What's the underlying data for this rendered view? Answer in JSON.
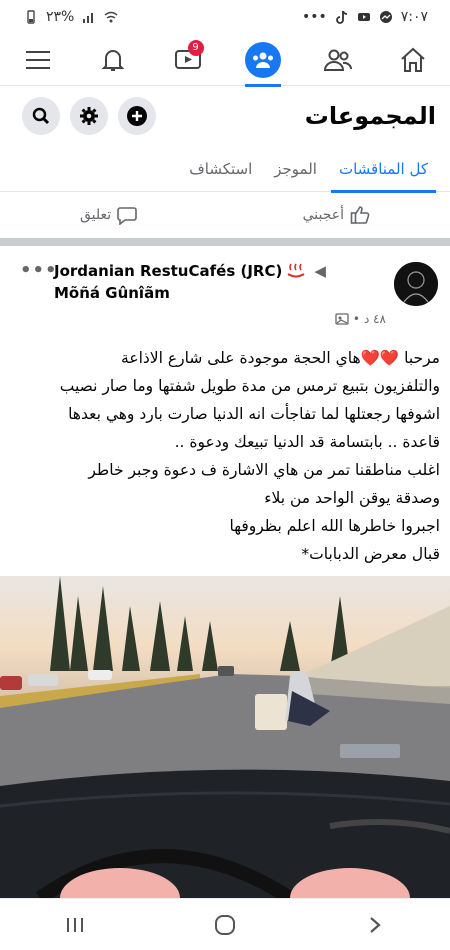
{
  "status_bar": {
    "time": "٧:٠٧",
    "battery": "٢٣%",
    "more": "•••"
  },
  "nav": {
    "items": [
      {
        "icon": "menu-icon"
      },
      {
        "icon": "bell-icon"
      },
      {
        "icon": "video-icon",
        "badge": "9"
      },
      {
        "icon": "groups-icon",
        "active": true
      },
      {
        "icon": "friends-icon"
      },
      {
        "icon": "home-icon"
      }
    ]
  },
  "header": {
    "title": "المجموعات"
  },
  "tabs": [
    {
      "label": "كل المناقشات",
      "active": true
    },
    {
      "label": "الموجز"
    },
    {
      "label": "استكشاف"
    }
  ],
  "reactions": {
    "like_label": "أعجبني",
    "comment_label": "تعليق"
  },
  "post": {
    "group_name": "Jordanian RestuCafés (JRC)",
    "author": "Mõñá Gûnîãm",
    "time": "٤٨ د",
    "text_lines": [
      "مرحبا ❤️❤️هاي الحجة موجودة على شارع الاذاعة",
      "والتلفزيون بتبيع ترمس من مدة طويل شفتها وما صار نصيب",
      "اشوفها رجعتلها لما تفاجأت انه الدنيا صارت بارد وهي بعدها",
      "قاعدة .. بابتسامة قد الدنيا تبيعك ودعوة ..",
      "اغلب مناطقنا تمر من هاي الاشارة ف دعوة وجبر خاطر",
      "وصدقة يوقن الواحد من بلاء",
      "اجبروا خاطرها الله اعلم بظروفها",
      "قبال معرض الدبابات*"
    ]
  },
  "colors": {
    "accent": "#1877f2",
    "badge": "#e41e3f",
    "divider": "#c9ccd1"
  }
}
